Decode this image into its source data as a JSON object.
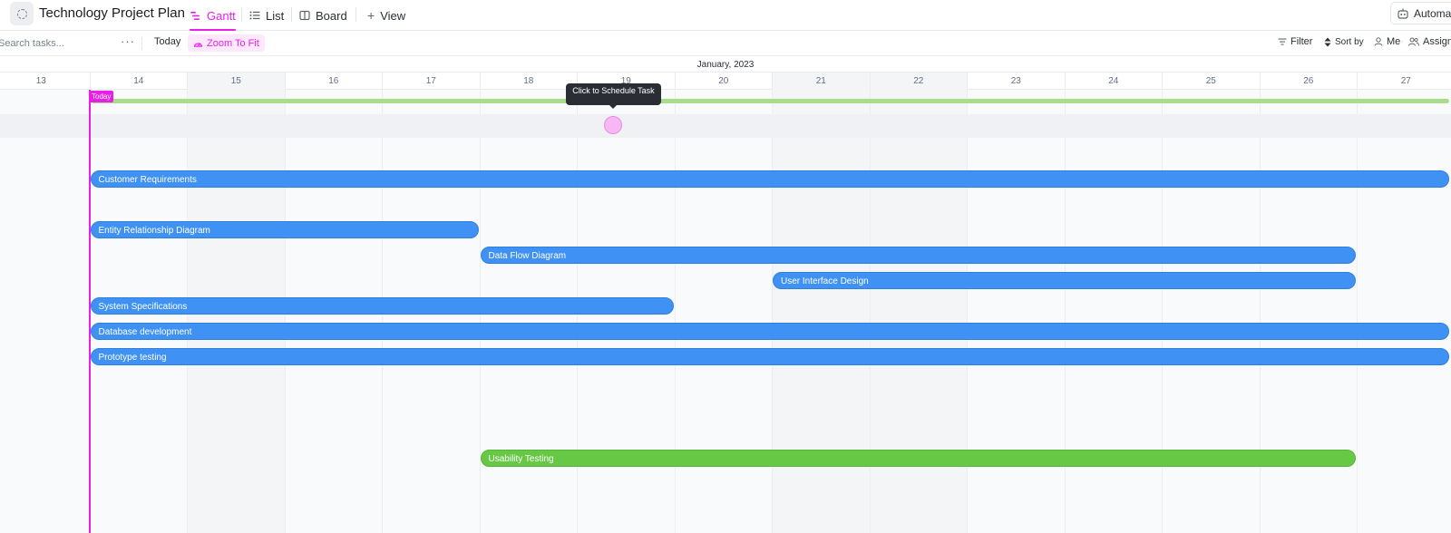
{
  "header": {
    "title": "Technology Project Plan",
    "tabs": [
      {
        "label": "Gantt",
        "icon": "gantt-icon",
        "active": true
      },
      {
        "label": "List",
        "icon": "list-icon",
        "active": false
      },
      {
        "label": "Board",
        "icon": "board-icon",
        "active": false
      }
    ],
    "add_view_label": "View",
    "automate_label": "Automate"
  },
  "toolbar": {
    "search_placeholder": "Search tasks...",
    "more_label": "···",
    "today_label": "Today",
    "zoom_label": "Zoom To Fit",
    "filter_label": "Filter",
    "sort_label": "Sort by",
    "me_label": "Me",
    "assignee_label": "Assignee"
  },
  "timeline": {
    "month": "January, 2023",
    "days": [
      "13",
      "14",
      "15",
      "16",
      "17",
      "18",
      "19",
      "20",
      "21",
      "22",
      "23",
      "24",
      "25",
      "26",
      "27"
    ],
    "weekend_days": [
      "15",
      "21",
      "22"
    ],
    "today_label": "Today",
    "tooltip": "Click to Schedule Task"
  },
  "tasks": [
    {
      "name": "Customer Requirements",
      "start": "14",
      "end": "27",
      "color": "#3f91f4"
    },
    {
      "name": "Entity Relationship Diagram",
      "start": "14",
      "end": "17",
      "color": "#3f91f4"
    },
    {
      "name": "Data Flow Diagram",
      "start": "18",
      "end": "26",
      "color": "#3f91f4"
    },
    {
      "name": "User Interface Design",
      "start": "21",
      "end": "26",
      "color": "#3f91f4"
    },
    {
      "name": "System Specifications",
      "start": "14",
      "end": "19",
      "color": "#3f91f4"
    },
    {
      "name": "Database development",
      "start": "14",
      "end": "27",
      "color": "#3f91f4"
    },
    {
      "name": "Prototype testing",
      "start": "14",
      "end": "27",
      "color": "#3f91f4"
    },
    {
      "name": "Usability Testing",
      "start": "18",
      "end": "26",
      "color": "#66c845"
    }
  ],
  "colors": {
    "accent": "#e91ee8",
    "task_blue": "#3f91f4",
    "task_green": "#66c845",
    "progress_green": "#a9dd8c"
  }
}
